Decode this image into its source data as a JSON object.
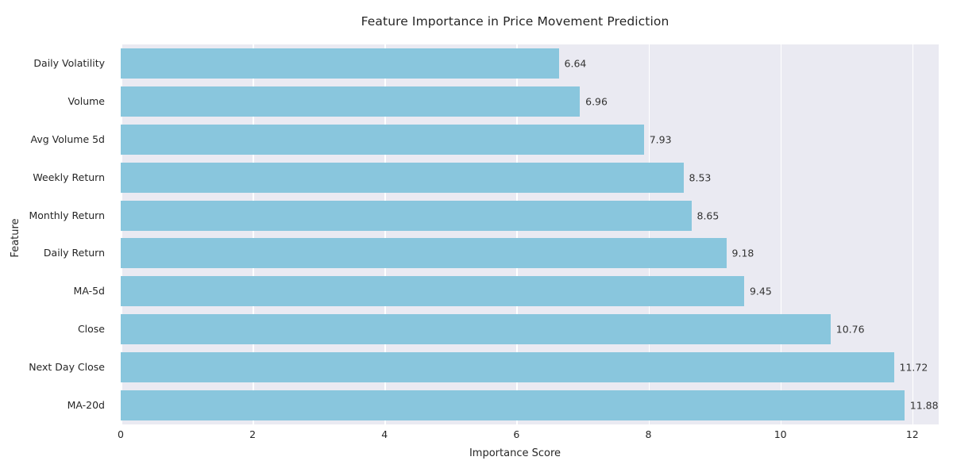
{
  "chart_data": {
    "type": "bar",
    "orientation": "horizontal",
    "title": "Feature Importance in Price Movement Prediction",
    "xlabel": "Importance Score",
    "ylabel": "Feature",
    "categories": [
      "Daily Volatility",
      "Volume",
      "Avg Volume 5d",
      "Weekly Return",
      "Monthly Return",
      "Daily Return",
      "MA-5d",
      "Close",
      "Next Day Close",
      "MA-20d"
    ],
    "values": [
      6.64,
      6.96,
      7.93,
      8.53,
      8.65,
      9.18,
      9.45,
      10.76,
      11.72,
      11.88
    ],
    "value_labels": [
      "6.64",
      "6.96",
      "7.93",
      "8.53",
      "8.65",
      "9.18",
      "9.45",
      "10.76",
      "11.72",
      "11.88"
    ],
    "xlim": [
      0,
      12.4
    ],
    "xticks": [
      0,
      2,
      4,
      6,
      8,
      10,
      12
    ],
    "xtick_labels": [
      "0",
      "2",
      "4",
      "6",
      "8",
      "10",
      "12"
    ],
    "grid": "vertical-only",
    "legend": "none",
    "bar_color": "#89C6DD",
    "plot_background": "#EAEAF2",
    "gridline_color": "#FFFFFF",
    "figure_background": "#FFFFFF",
    "text_color": "#262626"
  }
}
